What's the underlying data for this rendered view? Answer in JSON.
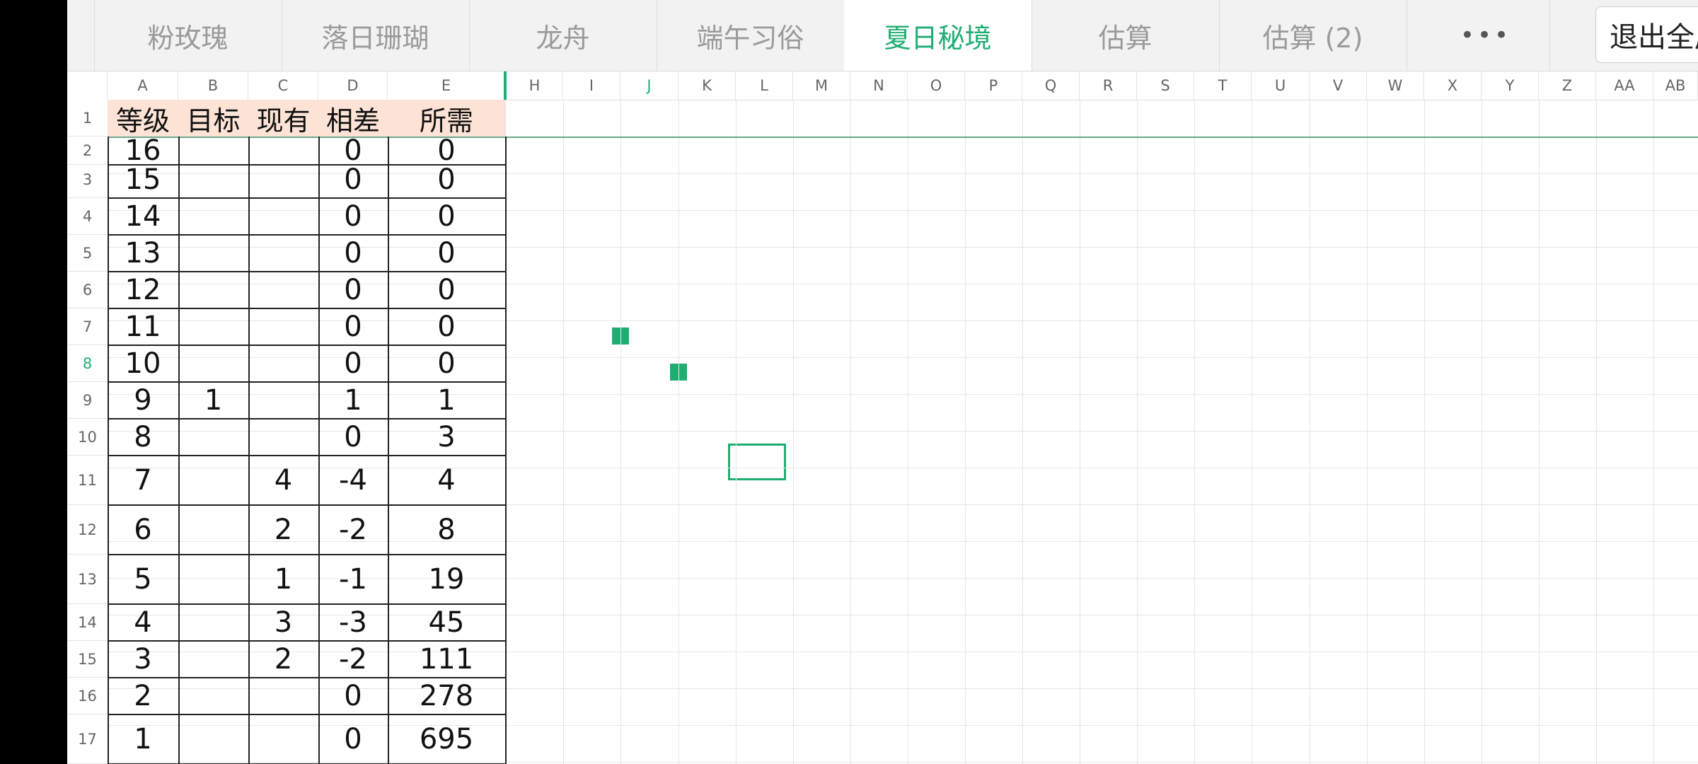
{
  "tabs": [
    "粉玫瑰",
    "落日珊瑚",
    "龙舟",
    "端午习俗",
    "夏日秘境",
    "估算",
    "估算 (2)"
  ],
  "active_tab": "夏日秘境",
  "more_label": "•••",
  "exit_fullscreen_label": "退出全屏",
  "columns": [
    "A",
    "B",
    "C",
    "D",
    "E",
    "H",
    "I",
    "J",
    "K",
    "L",
    "M",
    "N",
    "O",
    "P",
    "Q",
    "R",
    "S",
    "T",
    "U",
    "V",
    "W",
    "X",
    "Y",
    "Z",
    "AA",
    "AB"
  ],
  "active_column": "J",
  "row_numbers": [
    "1",
    "2",
    "3",
    "4",
    "5",
    "6",
    "7",
    "8",
    "9",
    "10",
    "11",
    "12",
    "13",
    "14",
    "15",
    "16",
    "17"
  ],
  "active_row": "8",
  "table": {
    "headers": [
      "等级",
      "目标",
      "现有",
      "相差",
      "所需"
    ],
    "rows": [
      [
        "16",
        "",
        "",
        "0",
        "0"
      ],
      [
        "15",
        "",
        "",
        "0",
        "0"
      ],
      [
        "14",
        "",
        "",
        "0",
        "0"
      ],
      [
        "13",
        "",
        "",
        "0",
        "0"
      ],
      [
        "12",
        "",
        "",
        "0",
        "0"
      ],
      [
        "11",
        "",
        "",
        "0",
        "0"
      ],
      [
        "10",
        "",
        "",
        "0",
        "0"
      ],
      [
        "9",
        "1",
        "",
        "1",
        "1"
      ],
      [
        "8",
        "",
        "",
        "0",
        "3"
      ],
      [
        "7",
        "",
        "4",
        "-4",
        "4"
      ],
      [
        "6",
        "",
        "2",
        "-2",
        "8"
      ],
      [
        "5",
        "",
        "1",
        "-1",
        "19"
      ],
      [
        "4",
        "",
        "3",
        "-3",
        "45"
      ],
      [
        "3",
        "",
        "2",
        "-2",
        "111"
      ],
      [
        "2",
        "",
        "",
        "0",
        "278"
      ],
      [
        "1",
        "",
        "",
        "0",
        "695"
      ]
    ]
  },
  "colors": {
    "accent": "#1fae72",
    "header_fill": "#fde3d6"
  }
}
